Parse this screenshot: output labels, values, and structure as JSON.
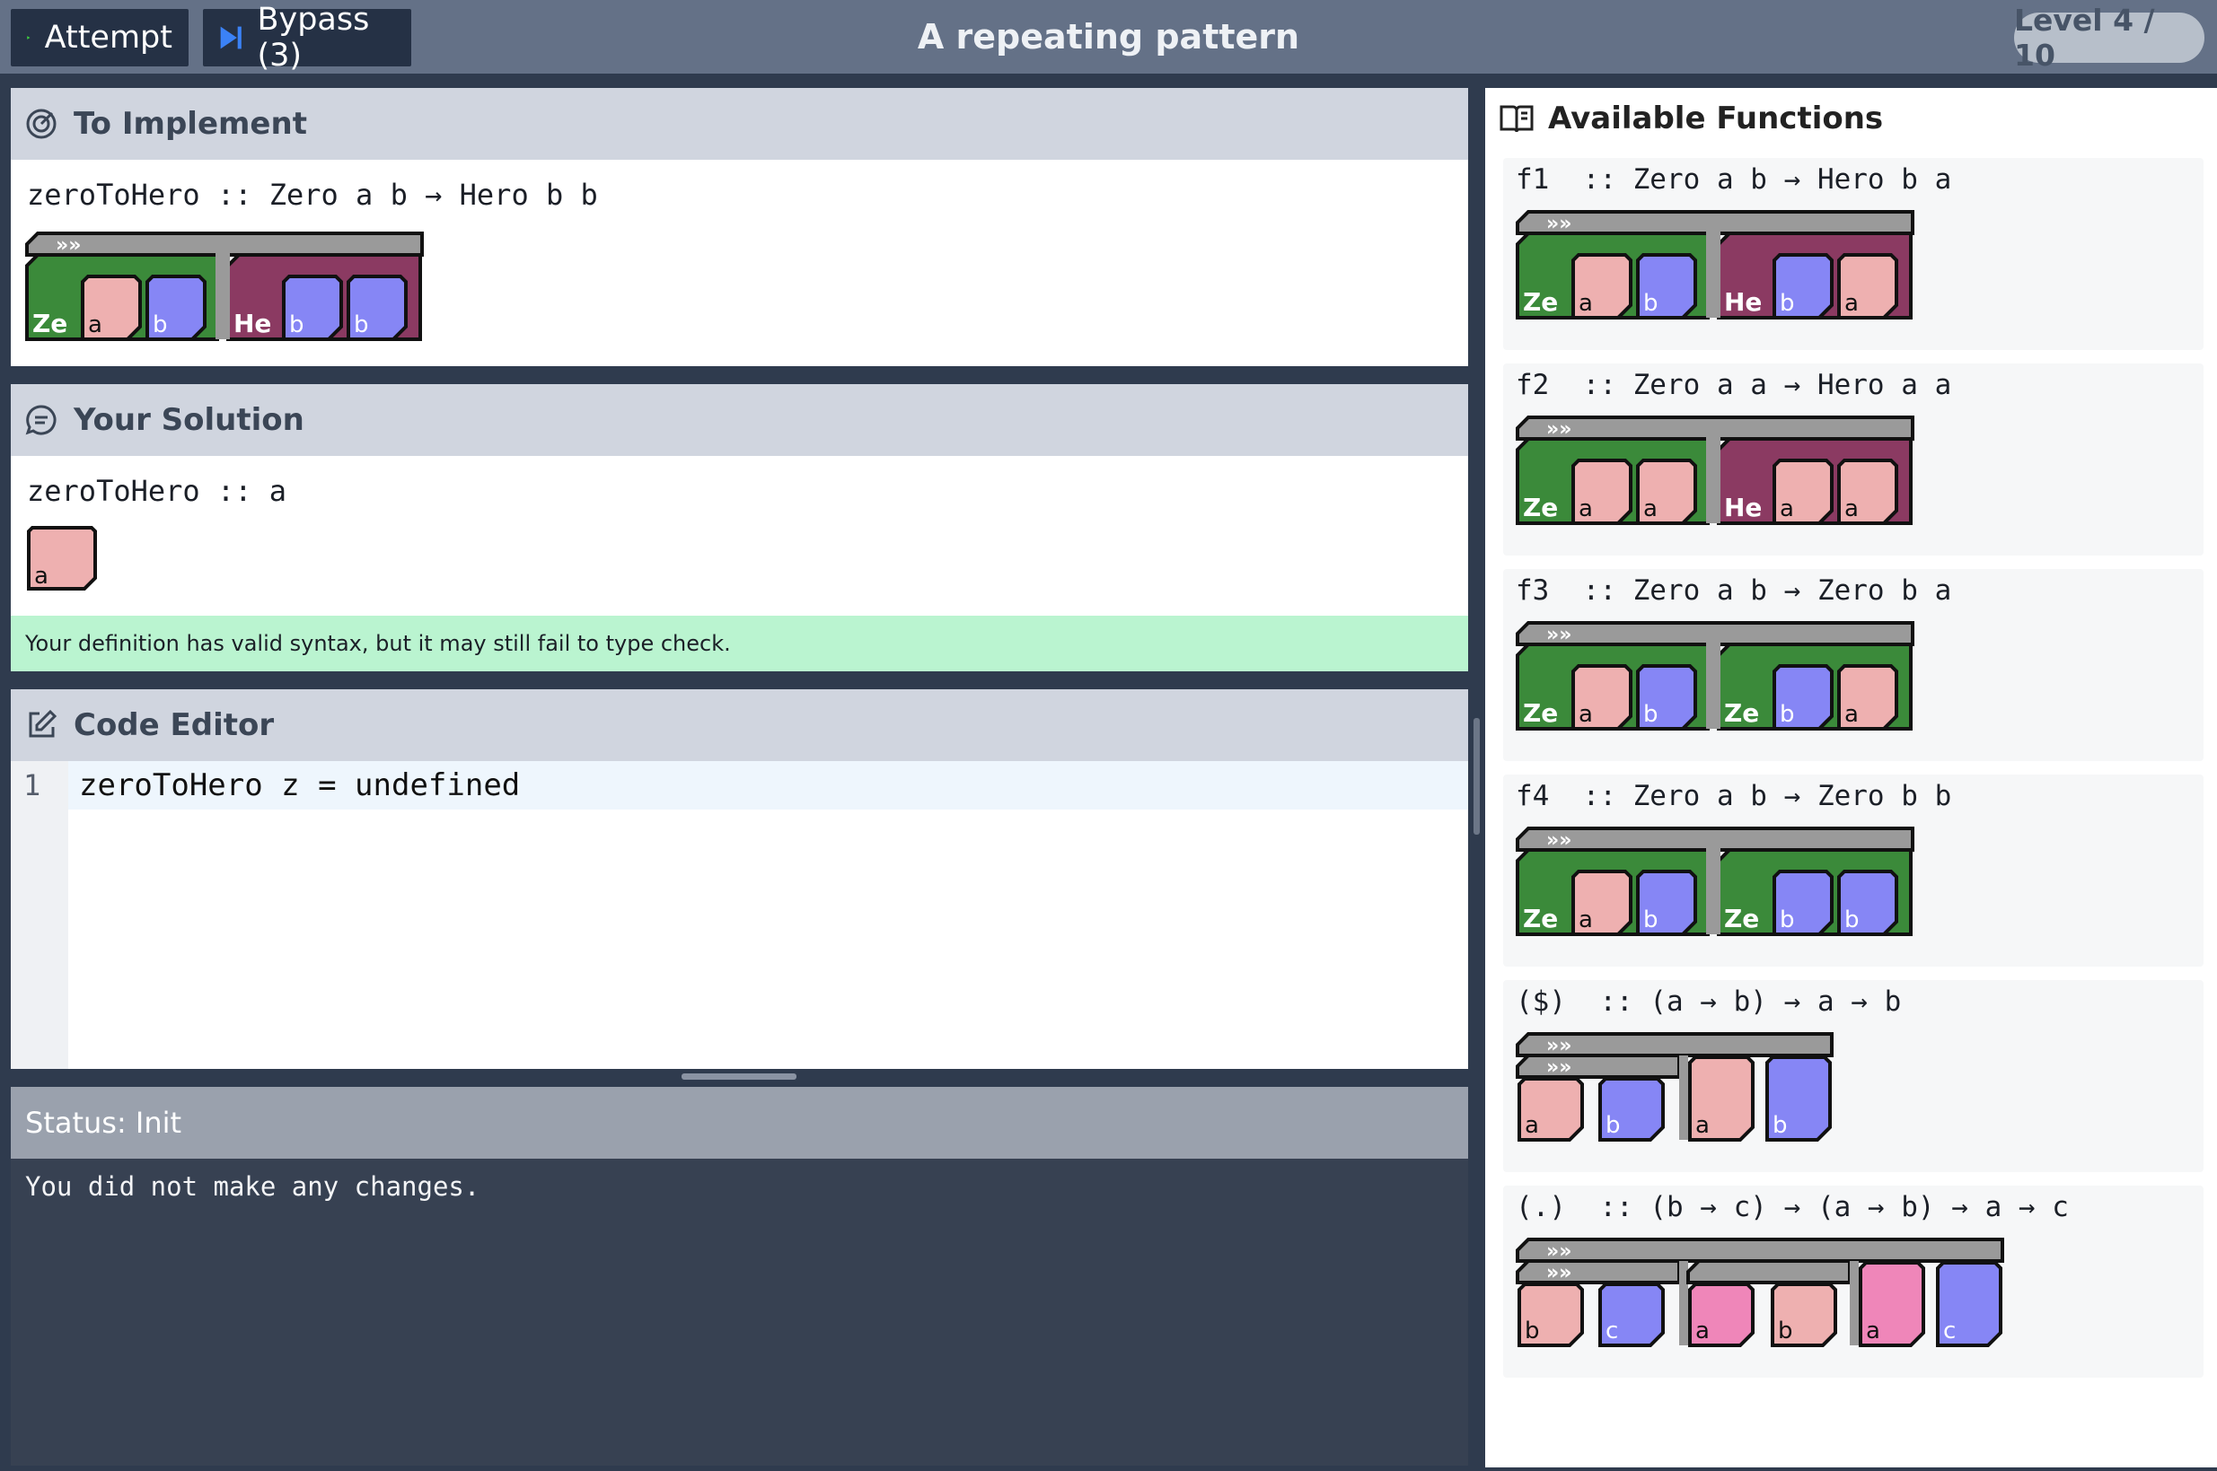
{
  "toolbar": {
    "attempt_label": "Attempt",
    "bypass_label": "Bypass (3)"
  },
  "title": "A repeating pattern",
  "level": "Level 4 / 10",
  "to_implement": {
    "heading": "To Implement",
    "signature": "zeroToHero :: Zero a b → Hero b b"
  },
  "solution": {
    "heading": "Your Solution",
    "signature": "zeroToHero :: a",
    "message": "Your definition has valid syntax, but it may still fail to type check."
  },
  "editor": {
    "heading": "Code Editor",
    "line_number": "1",
    "code": "zeroToHero z = undefined"
  },
  "status": {
    "heading": "Status: Init",
    "message": "You did not make any changes."
  },
  "functions": {
    "heading": "Available Functions",
    "items": [
      {
        "signature": "f1  :: Zero a b → Hero b a"
      },
      {
        "signature": "f2  :: Zero a a → Hero a a"
      },
      {
        "signature": "f3  :: Zero a b → Zero b a"
      },
      {
        "signature": "f4  :: Zero a b → Zero b b"
      },
      {
        "signature": "($)  :: (a → b) → a → b"
      },
      {
        "signature": "(.)  :: (b → c) → (a → b) → a → c"
      }
    ]
  },
  "glyphs": {
    "ze": "Ze",
    "he": "He",
    "a": "a",
    "b": "b",
    "c": "c"
  },
  "colors": {
    "zero": "#3b8a3a",
    "hero": "#8b3a62",
    "a_block": "#eeb0b0",
    "b_block": "#8686f5",
    "c_block": "#8686f5",
    "arrow": "#9a9a9a",
    "highlight_a": "#ef86b9"
  }
}
